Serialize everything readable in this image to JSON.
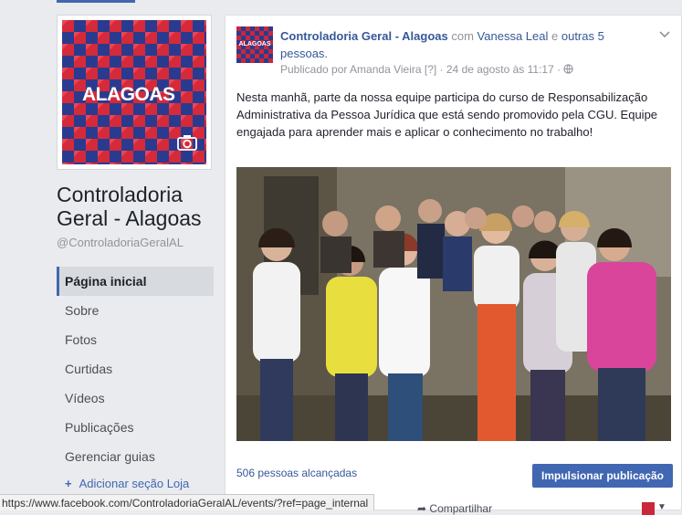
{
  "page": {
    "cover_logo_text": "ALAGOAS",
    "name": "Controladoria Geral - Alagoas",
    "handle": "@ControladoriaGeralAL"
  },
  "nav": {
    "items": [
      {
        "label": "Página inicial",
        "active": true
      },
      {
        "label": "Sobre"
      },
      {
        "label": "Fotos"
      },
      {
        "label": "Curtidas"
      },
      {
        "label": "Vídeos"
      },
      {
        "label": "Publicações"
      },
      {
        "label": "Gerenciar guias"
      }
    ],
    "add_shop": "Adicionar seção Loja"
  },
  "post": {
    "avatar_text": "ALAGOAS",
    "author": "Controladoria Geral - Alagoas",
    "with_word": "com",
    "tagged_person": "Vanessa Leal",
    "and_word": "e",
    "others": "outras 5 pessoas",
    "published_by": "Publicado por Amanda Vieira [?] · 24 de agosto às 11:17 ·",
    "text": "Nesta manhã, parte da nossa equipe participa do curso de Responsabilização Administrativa da Pessoa Jurídica que está sendo promovido pela CGU. Equipe engajada para aprender mais e aplicar o conhecimento no trabalho!",
    "reach": "506 pessoas alcançadas",
    "boost": "Impulsionar publicação",
    "share": "Compartilhar"
  },
  "status_url": "https://www.facebook.com/ControladoriaGeralAL/events/?ref=page_internal",
  "colors": {
    "accent": "#4267b2",
    "link": "#365899",
    "background": "#e9ebee"
  }
}
